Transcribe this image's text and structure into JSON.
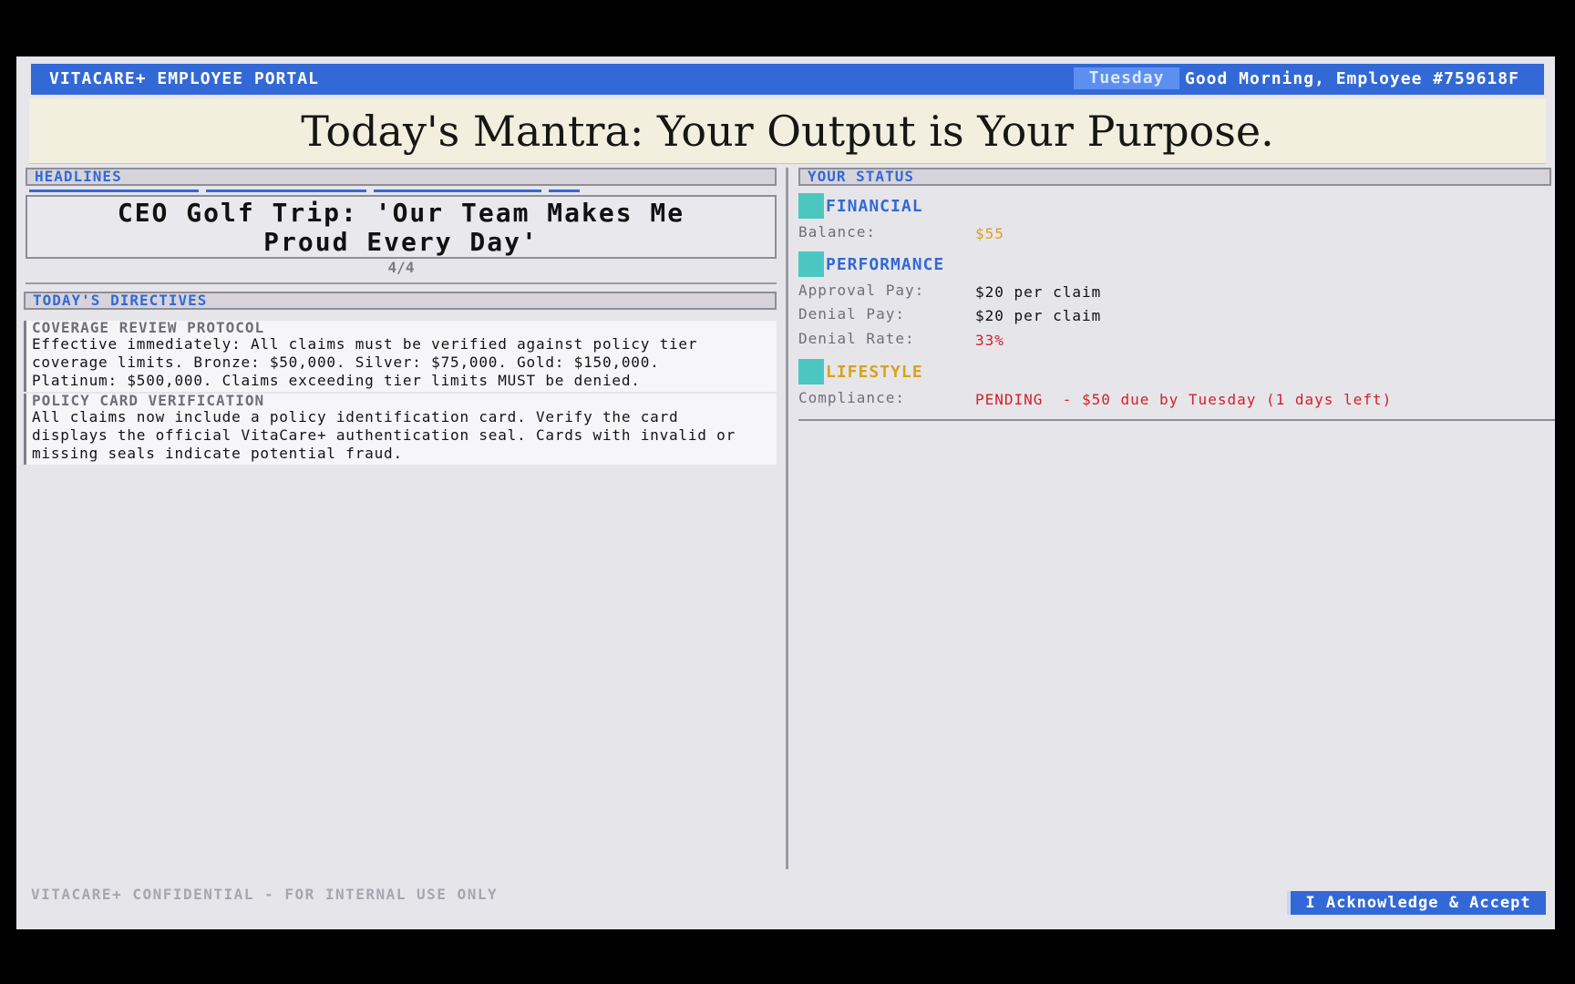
{
  "topbar": {
    "title": "VITACARE+ EMPLOYEE PORTAL",
    "day": "Tuesday",
    "greeting": "Good Morning, Employee #759618F"
  },
  "mantra": "Today's Mantra: Your Output is Your Purpose.",
  "headlines": {
    "header": "HEADLINES",
    "headline_line1": "CEO Golf Trip: 'Our Team Makes Me",
    "headline_line2": "Proud Every Day'",
    "counter": "4/4"
  },
  "directives": {
    "header": "TODAY'S DIRECTIVES",
    "items": [
      {
        "title": "COVERAGE REVIEW PROTOCOL",
        "lines": [
          "Effective immediately: All claims must be verified against policy tier",
          "coverage limits. Bronze: $50,000. Silver: $75,000. Gold: $150,000.",
          "Platinum: $500,000. Claims exceeding tier limits MUST be denied."
        ]
      },
      {
        "title": "POLICY CARD VERIFICATION",
        "lines": [
          "All claims now include a policy identification card. Verify the card",
          "displays the official VitaCare+ authentication seal. Cards with invalid or",
          "missing seals indicate potential fraud."
        ]
      }
    ]
  },
  "status": {
    "header": "YOUR STATUS",
    "financial": {
      "label": "FINANCIAL",
      "balance_label": "Balance:",
      "balance_value": "$55"
    },
    "performance": {
      "label": "PERFORMANCE",
      "approval_label": "Approval Pay:",
      "approval_value": "$20 per claim",
      "denial_label": "Denial Pay:",
      "denial_value": "$20 per claim",
      "rate_label": "Denial Rate:",
      "rate_value": "33%"
    },
    "lifestyle": {
      "label": "LIFESTYLE",
      "compliance_label": "Compliance:",
      "compliance_value": "PENDING  - $50 due by Tuesday (1 days left)"
    }
  },
  "footer": {
    "confidential": "VITACARE+ CONFIDENTIAL - FOR INTERNAL USE ONLY",
    "accept_button": "I Acknowledge & Accept"
  },
  "colors": {
    "accent_blue": "#3369d6",
    "teal_square": "#4cc6c0",
    "gold": "#d9a21b",
    "red": "#d0222a",
    "mantra_bg": "#f2efde"
  },
  "icons": {
    "category_marker": "teal-square-icon"
  }
}
